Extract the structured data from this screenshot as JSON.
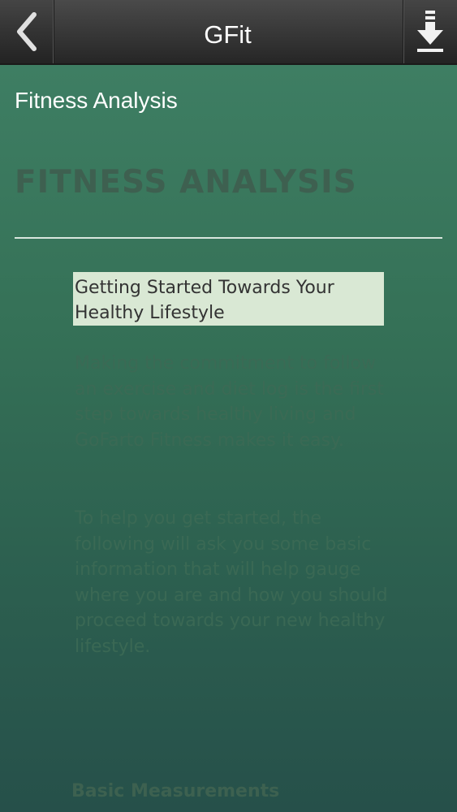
{
  "app": {
    "title": "GFit"
  },
  "nav": {
    "back_icon": "chevron-left-icon",
    "download_icon": "download-icon"
  },
  "page": {
    "heading": "Fitness Analysis",
    "big_title": "FITNESS ANALYSIS",
    "highlight": "Getting Started Towards Your Healthy Lifestyle",
    "paragraph1": "Making the commitment to follow an exercise and diet log is the first step towards healthy living and GoFarto Fitness makes it easy.",
    "paragraph2": "To help you get started, the following will ask you some basic information that will help gauge where you are and how you should proceed towards your new healthy lifestyle.",
    "section_heading": "Basic Measurements"
  },
  "colors": {
    "navbar": "#333333",
    "content_top": "#3e7e63",
    "content_bottom": "#26504a",
    "highlight_bg": "#d9e8d4"
  }
}
